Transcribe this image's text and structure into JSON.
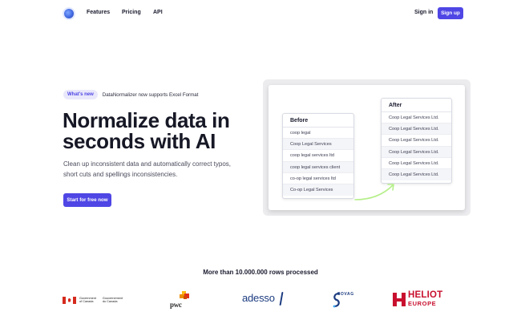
{
  "nav": {
    "links": [
      "Features",
      "Pricing",
      "API"
    ],
    "sign_in": "Sign in",
    "sign_up": "Sign up"
  },
  "hero": {
    "badge": "What's new",
    "badge_text": "DataNormalizer now supports Excel Format",
    "headline_line1": "Normalize data in",
    "headline_line2": "seconds with AI",
    "subtitle": "Clean up inconsistent data and automatically correct typos, short cuts and spellings inconsistencies.",
    "cta": "Start for free now"
  },
  "demo": {
    "before_title": "Before",
    "before_rows": [
      "coop legal",
      "Coop Legal Services",
      "coop legal services ltd",
      "coop legal services client",
      "co-op legal services ltd",
      "Co-op Legal Services"
    ],
    "after_title": "After",
    "after_rows": [
      "Coop Legal Services Ltd.",
      "Coop Legal Services Ltd.",
      "Coop Legal Services Ltd.",
      "Coop Legal Services Ltd.",
      "Coop Legal Services Ltd.",
      "Coop Legal Services Ltd."
    ],
    "arrow_color": "#b5ef8a"
  },
  "trust": {
    "processed": "More than 10.000.000 rows processed",
    "canada_en_1": "Government",
    "canada_en_2": "of Canada",
    "canada_fr_1": "Gouvernement",
    "canada_fr_2": "du Canada",
    "pwc": "pwc",
    "adesso": "adesso",
    "sovag": "SOVAG",
    "heliot_1": "HELIOT",
    "heliot_2": "EUROPE"
  },
  "colors": {
    "accent": "#4f46e5",
    "heliot_red": "#c8102e",
    "canada_red": "#d52b1e",
    "adesso_blue": "#1c3c80"
  }
}
